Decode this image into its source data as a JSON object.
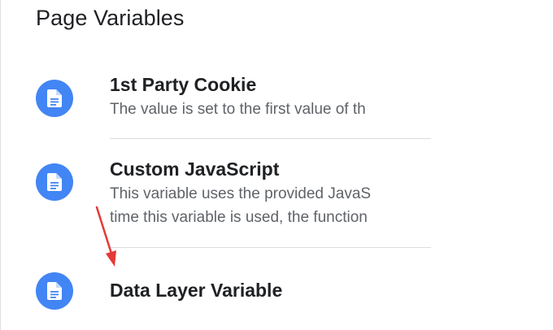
{
  "section": {
    "title": "Page Variables"
  },
  "items": [
    {
      "title": "1st Party Cookie",
      "description": "The value is set to the first value of th",
      "icon": "document-icon"
    },
    {
      "title": "Custom JavaScript",
      "description_lines": [
        "This variable uses the provided JavaS",
        "time this variable is used, the function"
      ],
      "icon": "document-icon"
    },
    {
      "title": "Data Layer Variable",
      "icon": "document-icon"
    }
  ],
  "colors": {
    "icon_background": "#4285f4",
    "annotation_arrow": "#e53935",
    "title_text": "#202124",
    "description_text": "#5f6368",
    "divider": "#dadce0"
  }
}
